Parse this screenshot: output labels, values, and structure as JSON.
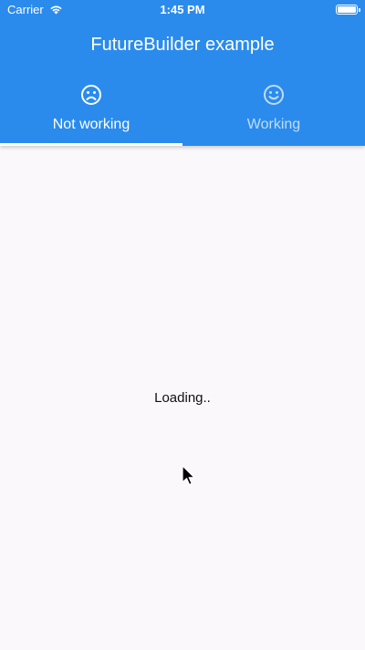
{
  "status_bar": {
    "carrier": "Carrier",
    "time": "1:45 PM",
    "wifi_icon": "wifi-icon",
    "battery_icon": "battery-icon"
  },
  "app_bar": {
    "title": "FutureBuilder example",
    "background_color": "#2a8bec"
  },
  "tabs": [
    {
      "label": "Not working",
      "icon": "sad-face-icon",
      "selected": true
    },
    {
      "label": "Working",
      "icon": "happy-face-icon",
      "selected": false
    }
  ],
  "content": {
    "loading_text": "Loading.."
  }
}
